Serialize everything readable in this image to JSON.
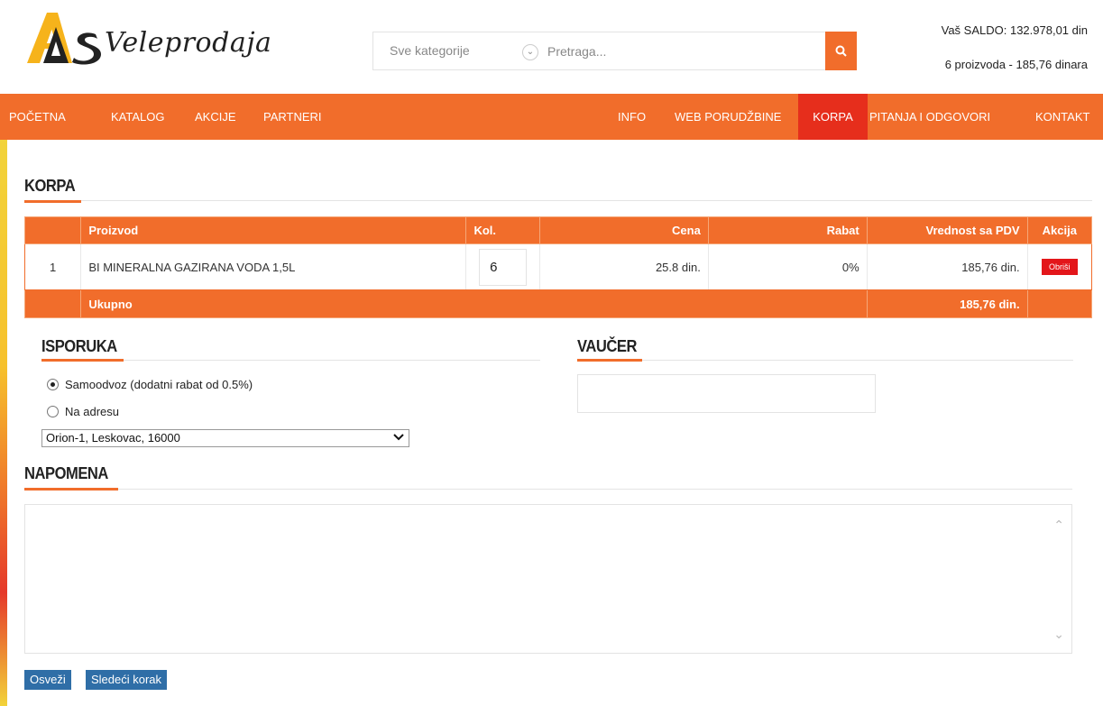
{
  "header": {
    "logo_text": "Veleprodaja",
    "search": {
      "category": "Sve kategorije",
      "placeholder": "Pretraga..."
    },
    "saldo": "Vaš SALDO: 132.978,01 din",
    "cart_summary": "6 proizvoda - 185,76 dinara"
  },
  "nav": {
    "left": [
      "POČETNA",
      "KATALOG",
      "AKCIJE",
      "PARTNERI"
    ],
    "right": [
      "INFO",
      "WEB PORUDŽBINE",
      "KORPA",
      "PITANJA I ODGOVORI",
      "KONTAKT"
    ],
    "active": "KORPA"
  },
  "cart": {
    "title": "KORPA",
    "columns": {
      "num": "",
      "product": "Proizvod",
      "qty": "Kol.",
      "price": "Cena",
      "discount": "Rabat",
      "total": "Vrednost sa PDV",
      "action": "Akcija"
    },
    "rows": [
      {
        "num": "1",
        "product": "BI MINERALNA GAZIRANA VODA 1,5L",
        "qty": "6",
        "price": "25.8 din.",
        "discount": "0%",
        "total": "185,76 din.",
        "action": "Obriši"
      }
    ],
    "footer": {
      "label": "Ukupno",
      "total": "185,76 din."
    }
  },
  "delivery": {
    "title": "ISPORUKA",
    "options": [
      {
        "label": "Samoodvoz (dodatni rabat od 0.5%)",
        "checked": true
      },
      {
        "label": "Na adresu",
        "checked": false
      }
    ],
    "address": "Orion-1, Leskovac, 16000"
  },
  "voucher": {
    "title": "VAUČER",
    "value": ""
  },
  "note": {
    "title": "NAPOMENA",
    "value": ""
  },
  "buttons": {
    "refresh": "Osveži",
    "next": "Sledeći korak"
  },
  "colors": {
    "accent": "#f16d2b",
    "active_nav": "#e62e1c",
    "delete": "#e3161a",
    "button_blue": "#2f6ea7"
  }
}
